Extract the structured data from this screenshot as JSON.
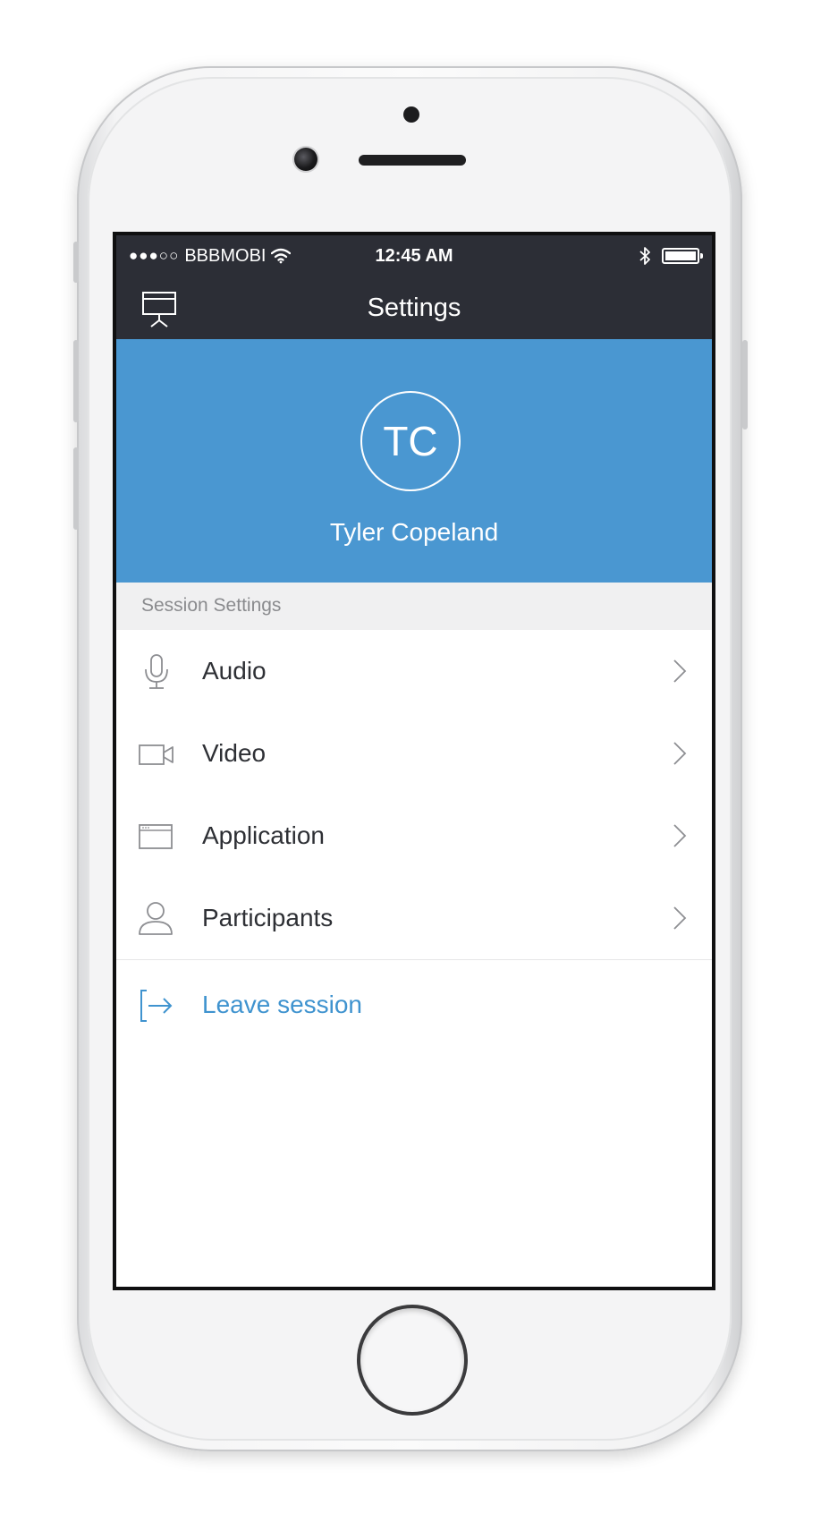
{
  "status_bar": {
    "signal": "●●●○○",
    "carrier": "BBBMOBI",
    "time": "12:45 AM"
  },
  "nav": {
    "title": "Settings"
  },
  "profile": {
    "initials": "TC",
    "name": "Tyler Copeland"
  },
  "section": {
    "header": "Session Settings"
  },
  "menu": {
    "items": [
      {
        "label": "Audio",
        "icon": "microphone-icon"
      },
      {
        "label": "Video",
        "icon": "video-camera-icon"
      },
      {
        "label": "Application",
        "icon": "application-window-icon"
      },
      {
        "label": "Participants",
        "icon": "person-icon"
      }
    ],
    "leave_label": "Leave session"
  },
  "colors": {
    "nav_background": "#2c2e36",
    "accent_blue": "#4a97d1",
    "link_blue": "#3f93cf",
    "section_gray": "#f0f0f1"
  }
}
